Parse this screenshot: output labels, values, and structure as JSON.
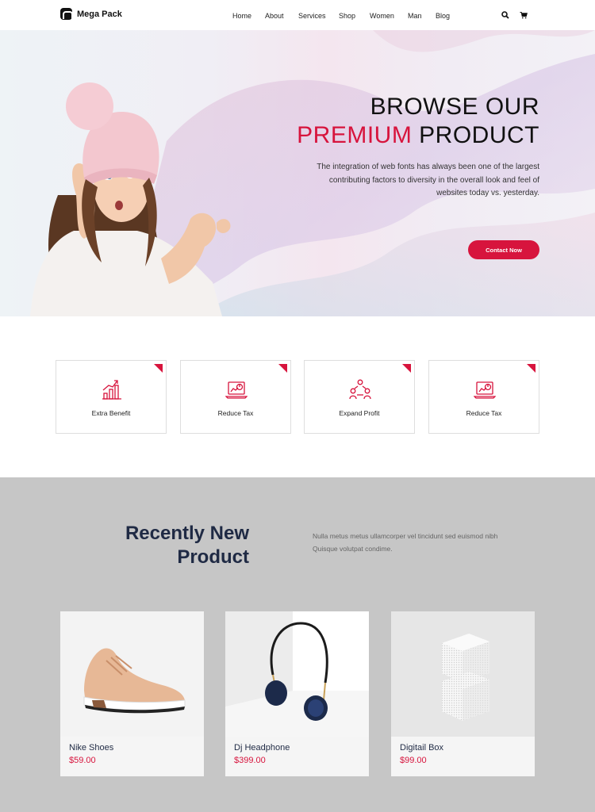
{
  "nav": {
    "brand": "Mega Pack",
    "items": [
      "Home",
      "About",
      "Services",
      "Shop",
      "Women",
      "Man",
      "Blog"
    ],
    "icons": [
      "search-icon",
      "cart-icon"
    ]
  },
  "hero": {
    "title_line1": "BROWSE OUR",
    "title_accent": "PREMIUM",
    "title_rest": " PRODUCT",
    "description": "The integration of web fonts has always been one of the largest contributing factors to diversity in the overall look and feel of websites today vs. yesterday.",
    "cta_label": "Contact Now"
  },
  "features": [
    {
      "label": "Extra Benefit",
      "icon": "growth-chart-icon"
    },
    {
      "label": "Reduce Tax",
      "icon": "laptop-report-icon"
    },
    {
      "label": "Expand Profit",
      "icon": "network-people-icon"
    },
    {
      "label": "Reduce Tax",
      "icon": "laptop-report-icon"
    }
  ],
  "recent": {
    "title_line1": "Recently New",
    "title_line2": "Product",
    "description": "Nulla metus metus ullamcorper vel tincidunt sed euismod nibh Quisque volutpat condime.",
    "products": [
      {
        "name": "Nike Shoes",
        "price": "$59.00"
      },
      {
        "name": "Dj Headphone",
        "price": "$399.00"
      },
      {
        "name": "Digitail Box",
        "price": "$99.00"
      }
    ]
  },
  "colors": {
    "accent": "#d7143d",
    "heading": "#1f2a44",
    "products_bg": "#c6c6c6"
  }
}
